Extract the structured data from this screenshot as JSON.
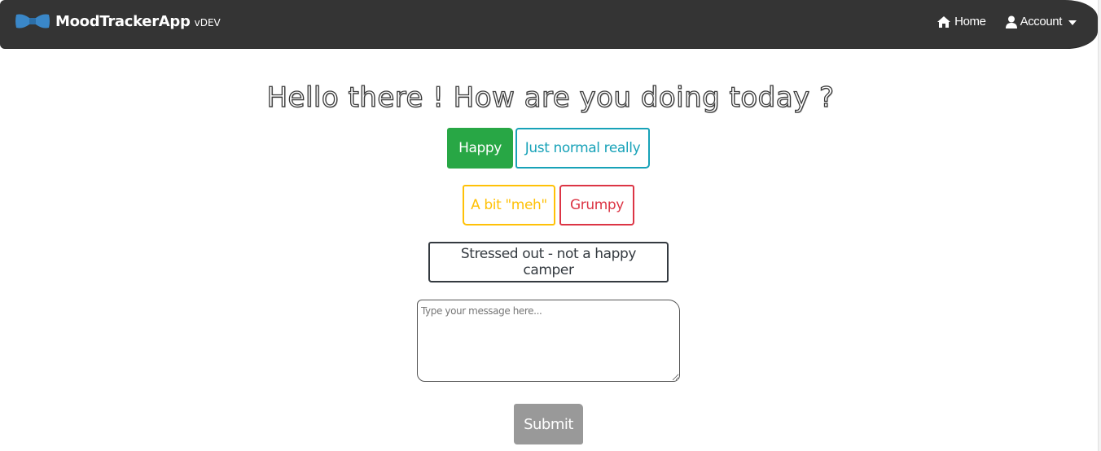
{
  "navbar": {
    "brand_name": "MoodTrackerApp",
    "brand_version": "vDEV",
    "logo_icon": "bowtie-icon",
    "home_label": "Home",
    "home_icon": "home-icon",
    "account_label": "Account",
    "account_icon": "user-icon",
    "background_color": "#343434"
  },
  "main": {
    "heading": "Hello there ! How are you doing today ?",
    "moods": [
      {
        "label": "Happy",
        "color": "#28a745",
        "selected": true
      },
      {
        "label": "Just normal really",
        "color": "#17a2b8",
        "selected": false
      },
      {
        "label": "A bit \"meh\"",
        "color": "#ffc107",
        "selected": false
      },
      {
        "label": "Grumpy",
        "color": "#dc3545",
        "selected": false
      },
      {
        "label": "Stressed out - not a happy camper",
        "color": "#343a40",
        "selected": false
      }
    ],
    "message_placeholder": "Type your message here...",
    "submit_label": "Submit"
  }
}
